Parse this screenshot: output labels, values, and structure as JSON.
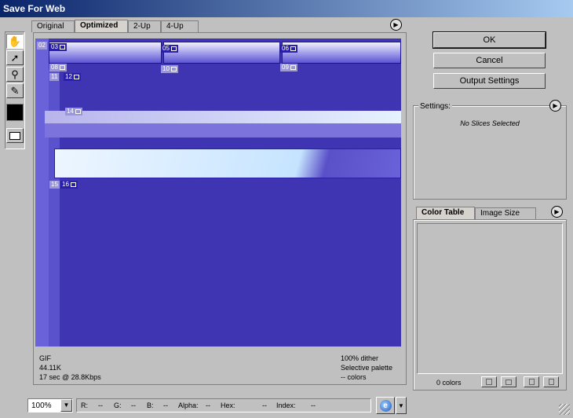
{
  "window": {
    "title": "Save For Web"
  },
  "tabs": [
    {
      "label": "Original"
    },
    {
      "label": "Optimized"
    },
    {
      "label": "2-Up"
    },
    {
      "label": "4-Up"
    }
  ],
  "slices": {
    "s02": "02",
    "s03": "03",
    "s05": "05",
    "s06": "06",
    "s08": "08",
    "s10": "10",
    "s09": "09",
    "s11": "11",
    "s12": "12",
    "s14": "14",
    "s15": "15",
    "s16": "16"
  },
  "info": {
    "format": "GIF",
    "size": "44.11K",
    "time": "17 sec @ 28.8Kbps",
    "dither": "100% dither",
    "palette": "Selective palette",
    "colors": "-- colors"
  },
  "buttons": {
    "ok": "OK",
    "cancel": "Cancel",
    "output_settings": "Output Settings"
  },
  "settings": {
    "label": "Settings:",
    "empty": "No Slices Selected"
  },
  "color_panel": {
    "tab_color_table": "Color Table",
    "tab_image_size": "Image Size",
    "colors_count": "0 colors"
  },
  "status": {
    "zoom": "100%",
    "r": "R:",
    "r_val": "--",
    "g": "G:",
    "g_val": "--",
    "b": "B:",
    "b_val": "--",
    "alpha": "Alpha:",
    "alpha_val": "--",
    "hex": "Hex:",
    "hex_val": "--",
    "index": "Index:",
    "index_val": "--"
  },
  "colors": {
    "titlebar_start": "#0a246a",
    "canvas_bg": "#3f35b3",
    "nav_strip": "#6a62d8"
  }
}
